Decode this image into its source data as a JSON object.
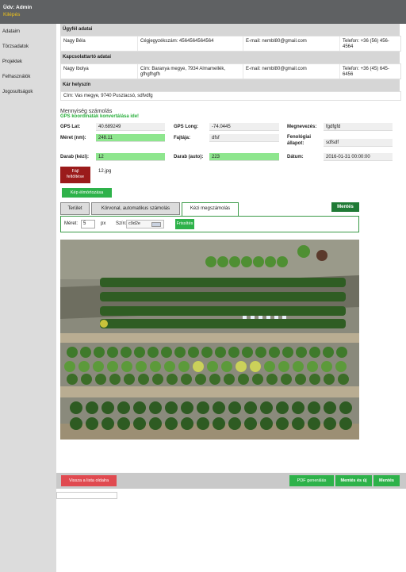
{
  "header": {
    "welcome": "Üdv: Admin",
    "logout": "Kilépés"
  },
  "sidebar": {
    "items": [
      {
        "label": "Adataim"
      },
      {
        "label": "Törzsadatok"
      },
      {
        "label": "Projektek"
      },
      {
        "label": "Felhasználók"
      },
      {
        "label": "Jogosultságok"
      }
    ]
  },
  "client": {
    "section_title": "Ügyfél adatai",
    "name": "Nagy Béla",
    "company_no": "Cégjegyzékszám: 4564564564564",
    "email": "E-mail: nembl80@gmail.com",
    "phone": "Telefon: +36 (56) 456-4564"
  },
  "contact": {
    "section_title": "Kapcsolattartó adatai",
    "name": "Nagy Ibolya",
    "address": "Cím: Baranya megye, 7934 Almamellék, gfhgfhgfh",
    "email": "E-mail: nembl80@gmail.com",
    "phone": "Telefon: +36 (45) 645-6456"
  },
  "damage": {
    "section_title": "Kár helyszín",
    "address": "Cím: Vas megye, 9740 Pusztacsó, sdfvdfg"
  },
  "calc": {
    "title": "Mennyiség számolás",
    "gps_link": "GPS koordináták konvertálása ide!",
    "gps_lat_label": "GPS Lat:",
    "gps_lat": "40.689249",
    "gps_long_label": "GPS Long:",
    "gps_long": "-74.0445",
    "name_label": "Megnevezés:",
    "name": "fgdfgfd",
    "size_label": "Méret (nm):",
    "size": "248.11",
    "species_label": "Fajtája:",
    "species": "dfsf",
    "pheno_label_1": "Fenológiai",
    "pheno_label_2": "állapot:",
    "pheno": "sdfsdf",
    "count_manual_label": "Darab (kézi):",
    "count_manual": "12",
    "count_auto_label": "Darab (auto):",
    "count_auto": "223",
    "date_label": "Dátum:",
    "date": "2016-01-31 00:00:00",
    "upload_btn_1": "Fájl",
    "upload_btn_2": "feltöltése",
    "file_name": "12.jpg",
    "preview_btn": "Kép élmórtozása"
  },
  "tabs": {
    "items": [
      "Terület",
      "Körvonal, automatikus számolás",
      "Kézi megszámolás"
    ],
    "active_index": 2,
    "save_label": "Mentés",
    "size_label": "Méret:",
    "size_value": "5",
    "size_unit": "px",
    "color_label": "Szín:",
    "color_value": "c9d2e",
    "refresh_label": "Frissítés"
  },
  "footer": {
    "back_label": "Vissza a lista oldalra",
    "pdf_label": "PDF generálás",
    "save_new_label": "Mentés és új",
    "save_label": "Mentés"
  },
  "colors": {
    "accent_green": "#2eb24a",
    "dark_green": "#1f7a35",
    "red": "#e04a50",
    "dark_red": "#9b1b1b"
  }
}
